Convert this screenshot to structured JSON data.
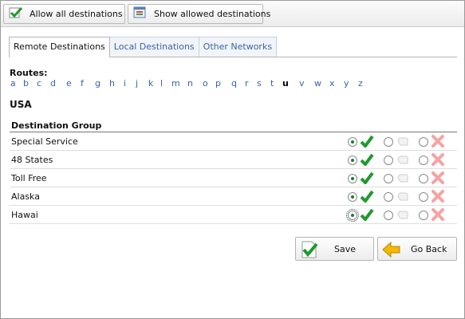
{
  "toolbar": {
    "allow_all_label": "Allow all destinations",
    "show_allowed_label": "Show allowed destinations"
  },
  "tabs": [
    {
      "label": "Remote Destinations",
      "active": true
    },
    {
      "label": "Local Destinations",
      "active": false
    },
    {
      "label": "Other Networks",
      "active": false
    }
  ],
  "routes": {
    "label": "Routes:",
    "letters": [
      "a",
      "b",
      "c",
      "d",
      "e",
      "f",
      "g",
      "h",
      "i",
      "j",
      "k",
      "l",
      "m",
      "n",
      "o",
      "p",
      "q",
      "r",
      "s",
      "t",
      "u",
      "v",
      "w",
      "x",
      "y",
      "z"
    ],
    "selected": "u"
  },
  "country": "USA",
  "table": {
    "header": "Destination Group",
    "rows": [
      {
        "name": "Special Service",
        "selected": "allow"
      },
      {
        "name": "48 States",
        "selected": "allow"
      },
      {
        "name": "Toll Free",
        "selected": "allow"
      },
      {
        "name": "Alaska",
        "selected": "allow"
      },
      {
        "name": "Hawai",
        "selected": "allow"
      }
    ]
  },
  "actions": {
    "save_label": "Save",
    "go_back_label": "Go Back"
  },
  "colors": {
    "link": "#3a63a8",
    "check": "#1f9a2e",
    "deny": "#f26d6d",
    "back_arrow": "#f5b700"
  }
}
